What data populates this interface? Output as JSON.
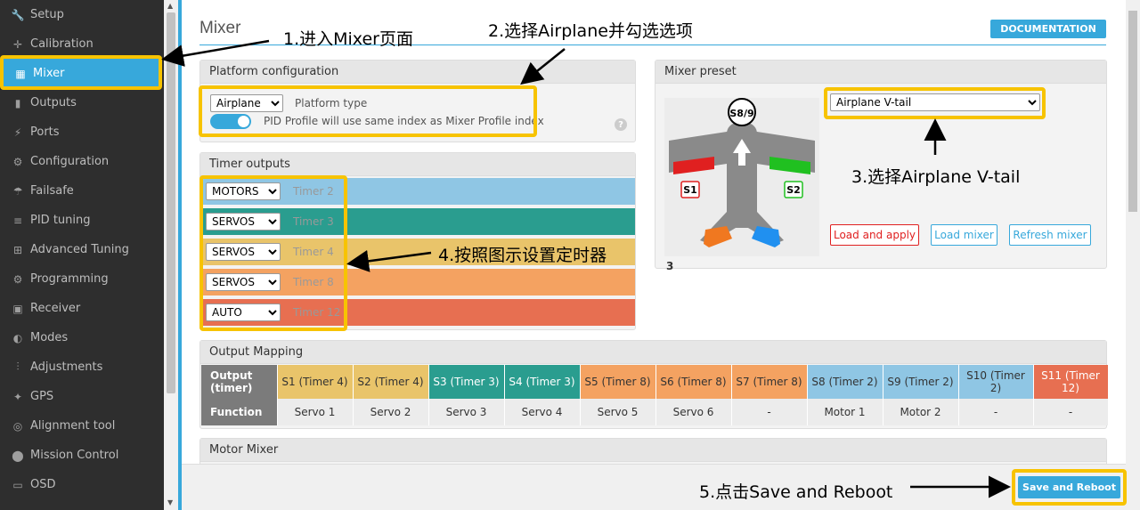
{
  "sidebar": {
    "items": [
      {
        "label": "Setup",
        "icon": "wrench-icon",
        "glyph": "🔧"
      },
      {
        "label": "Calibration",
        "icon": "crosshair-icon",
        "glyph": "✛"
      },
      {
        "label": "Mixer",
        "icon": "mixer-icon",
        "glyph": "▦"
      },
      {
        "label": "Outputs",
        "icon": "bottle-icon",
        "glyph": "▮"
      },
      {
        "label": "Ports",
        "icon": "plug-icon",
        "glyph": "⚡"
      },
      {
        "label": "Configuration",
        "icon": "gear-icon",
        "glyph": "⚙"
      },
      {
        "label": "Failsafe",
        "icon": "parachute-icon",
        "glyph": "☂"
      },
      {
        "label": "PID tuning",
        "icon": "sliders-icon",
        "glyph": "≡"
      },
      {
        "label": "Advanced Tuning",
        "icon": "sitemap-icon",
        "glyph": "⊞"
      },
      {
        "label": "Programming",
        "icon": "gear-icon",
        "glyph": "⚙"
      },
      {
        "label": "Receiver",
        "icon": "receiver-icon",
        "glyph": "▣"
      },
      {
        "label": "Modes",
        "icon": "toggles-icon",
        "glyph": "◐"
      },
      {
        "label": "Adjustments",
        "icon": "sliders-icon",
        "glyph": "⫶"
      },
      {
        "label": "GPS",
        "icon": "satellite-icon",
        "glyph": "✦"
      },
      {
        "label": "Alignment tool",
        "icon": "compass-icon",
        "glyph": "◎"
      },
      {
        "label": "Mission Control",
        "icon": "map-marker-icon",
        "glyph": "⬤"
      },
      {
        "label": "OSD",
        "icon": "osd-icon",
        "glyph": "▭"
      }
    ],
    "active": "Mixer"
  },
  "header": {
    "title": "Mixer",
    "doc_button": "DOCUMENTATION"
  },
  "platform": {
    "heading": "Platform configuration",
    "type_value": "Airplane",
    "type_label": "Platform type",
    "toggle_label": "PID Profile will use same index as Mixer Profile index",
    "toggle_on": true,
    "help_glyph": "?"
  },
  "timers": {
    "heading": "Timer outputs",
    "rows": [
      {
        "mode": "MOTORS",
        "label": "Timer 2",
        "color": "#8fc6e4"
      },
      {
        "mode": "SERVOS",
        "label": "Timer 3",
        "color": "#2a9d8f"
      },
      {
        "mode": "SERVOS",
        "label": "Timer 4",
        "color": "#e9c46a"
      },
      {
        "mode": "SERVOS",
        "label": "Timer 8",
        "color": "#f4a261"
      },
      {
        "mode": "AUTO",
        "label": "Timer 12",
        "color": "#e76f51"
      }
    ]
  },
  "preset": {
    "heading": "Mixer preset",
    "selected": "Airplane V-tail",
    "load_apply": "Load and apply",
    "load_mixer": "Load mixer",
    "refresh_mixer": "Refresh mixer",
    "image_labels": {
      "center": "S8/9",
      "left": "S1",
      "right": "S2"
    },
    "stray_digit": "3"
  },
  "output_mapping": {
    "heading": "Output Mapping",
    "row_header_output": "Output (timer)",
    "row_header_function": "Function",
    "columns": [
      {
        "output": "S1 (Timer 4)",
        "function": "Servo 1",
        "color": "#e9c46a"
      },
      {
        "output": "S2 (Timer 4)",
        "function": "Servo 2",
        "color": "#e9c46a"
      },
      {
        "output": "S3 (Timer 3)",
        "function": "Servo 3",
        "color": "#2a9d8f"
      },
      {
        "output": "S4 (Timer 3)",
        "function": "Servo 4",
        "color": "#2a9d8f"
      },
      {
        "output": "S5 (Timer 8)",
        "function": "Servo 5",
        "color": "#f4a261"
      },
      {
        "output": "S6 (Timer 8)",
        "function": "Servo 6",
        "color": "#f4a261"
      },
      {
        "output": "S7 (Timer 8)",
        "function": "-",
        "color": "#f4a261"
      },
      {
        "output": "S8 (Timer 2)",
        "function": "Motor 1",
        "color": "#8fc6e4"
      },
      {
        "output": "S9 (Timer 2)",
        "function": "Motor 2",
        "color": "#8fc6e4"
      },
      {
        "output": "S10 (Timer 2)",
        "function": "-",
        "color": "#8fc6e4"
      },
      {
        "output": "S11 (Timer 12)",
        "function": "-",
        "color": "#e76f51"
      }
    ]
  },
  "motor_mixer": {
    "heading": "Motor Mixer"
  },
  "footer": {
    "save_reboot": "Save and Reboot"
  },
  "annotations": {
    "step1": "1.进入Mixer页面",
    "step2": "2.选择Airplane并勾选选项",
    "step3": "3.选择Airplane V-tail",
    "step4": "4.按照图示设置定时器",
    "step5": "5.点击Save and Reboot",
    "highlight_color": "#f7c300"
  }
}
